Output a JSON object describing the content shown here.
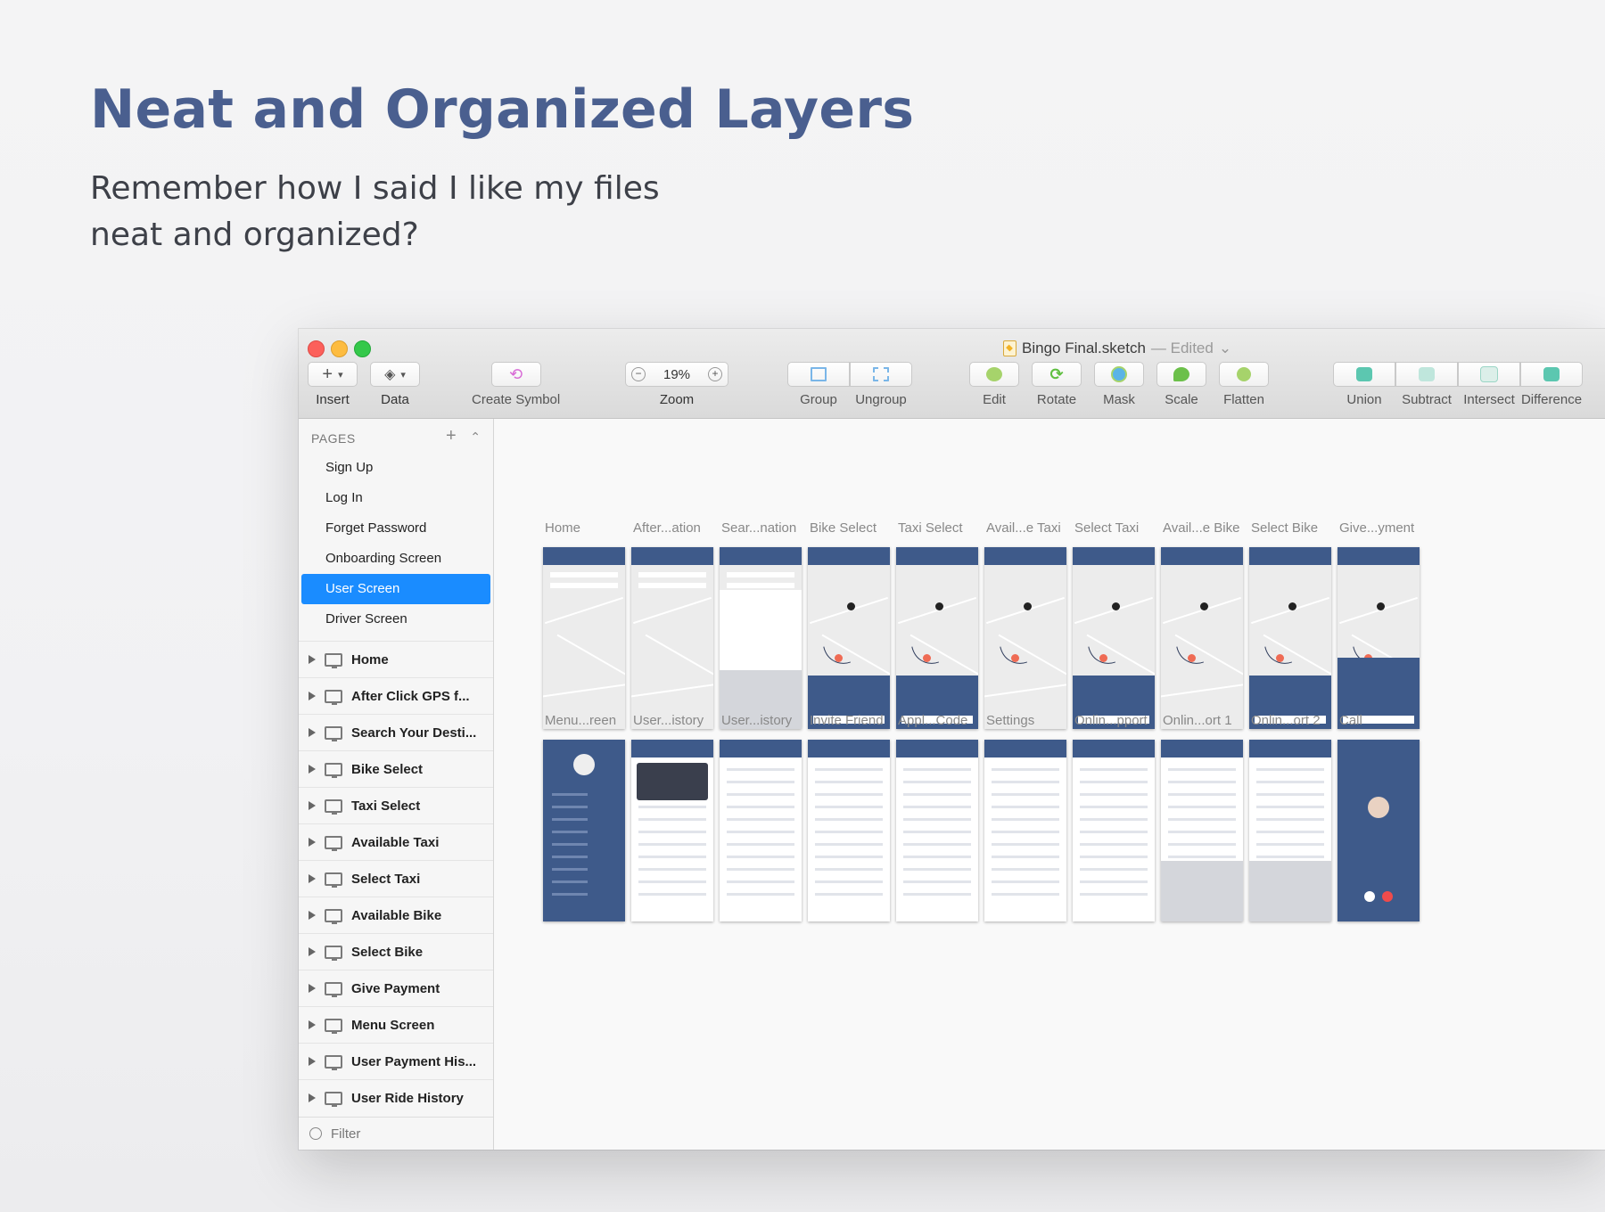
{
  "headline": "Neat and Organized Layers",
  "subheadline_line1": "Remember how I said I like my files",
  "subheadline_line2": "neat and organized?",
  "window": {
    "doc_name": "Bingo Final.sketch",
    "doc_status": "— Edited",
    "toolbar": {
      "insert": "Insert",
      "data": "Data",
      "create_symbol": "Create Symbol",
      "zoom_label": "Zoom",
      "zoom_value": "19%",
      "zoom_minus": "−",
      "zoom_plus": "+",
      "group": "Group",
      "ungroup": "Ungroup",
      "edit": "Edit",
      "rotate": "Rotate",
      "mask": "Mask",
      "scale": "Scale",
      "flatten": "Flatten",
      "union": "Union",
      "subtract": "Subtract",
      "intersect": "Intersect",
      "difference": "Difference"
    },
    "sidebar": {
      "pages_header": "PAGES",
      "pages": [
        "Sign Up",
        "Log In",
        "Forget Password",
        "Onboarding Screen",
        "User Screen",
        "Driver Screen"
      ],
      "selected_page": "User Screen",
      "artboards": [
        "Home",
        "After Click GPS f...",
        "Search Your Desti...",
        "Bike Select",
        "Taxi Select",
        "Available Taxi",
        "Select Taxi",
        "Available Bike",
        "Select Bike",
        "Give Payment",
        "Menu Screen",
        "User Payment His...",
        "User Ride History"
      ],
      "filter_label": "Filter"
    },
    "canvas": {
      "row1_labels": [
        "Home",
        "After...ation",
        "Sear...nation",
        "Bike Select",
        "Taxi Select",
        "Avail...e Taxi",
        "Select Taxi",
        "Avail...e Bike",
        "Select Bike",
        "Give...yment"
      ],
      "row2_labels": [
        "Menu...reen",
        "User...istory",
        "User...istory",
        "Invite Friend",
        "Appl...Code",
        "Settings",
        "Onlin...pport",
        "Onlin...ort 1",
        "Onlin...ort 2",
        "Call"
      ]
    },
    "colors": {
      "accent": "#1a8cff",
      "screen_navy": "#3e5a8a",
      "headline": "#4a5f8f"
    }
  }
}
